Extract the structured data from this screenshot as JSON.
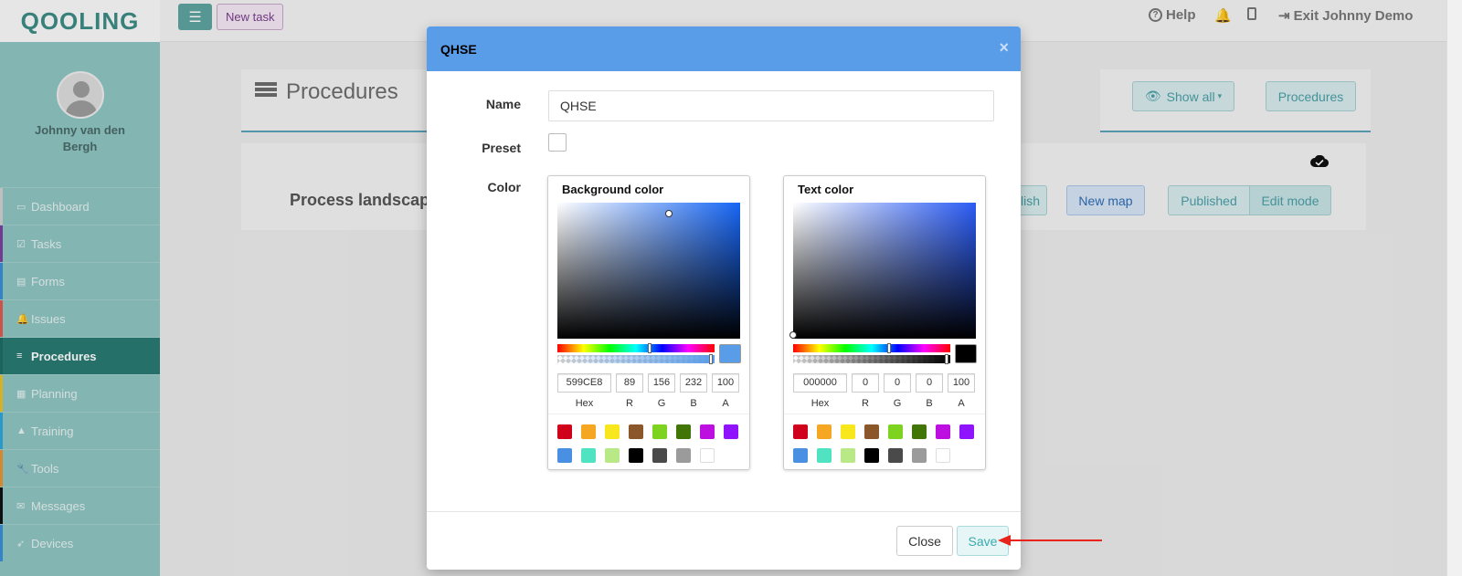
{
  "app": {
    "logo": "QOOLING",
    "new_task_label": "New task"
  },
  "topnav": {
    "help_label": "Help",
    "exit_label": "Exit Johnny Demo"
  },
  "user": {
    "name": "Johnny van den Bergh"
  },
  "sidebar": {
    "items": [
      {
        "label": "Dashboard",
        "icon": "monitor-icon",
        "accent": "#d0d0d0"
      },
      {
        "label": "Tasks",
        "icon": "check-square-icon",
        "accent": "#7b3fa0"
      },
      {
        "label": "Forms",
        "icon": "file-icon",
        "accent": "#3a8fd8"
      },
      {
        "label": "Issues",
        "icon": "bell-icon",
        "accent": "#e05a4f"
      },
      {
        "label": "Procedures",
        "icon": "list-icon",
        "accent": "#1f6b65",
        "active": true
      },
      {
        "label": "Planning",
        "icon": "calendar-icon",
        "accent": "#e6c229"
      },
      {
        "label": "Training",
        "icon": "graduation-icon",
        "accent": "#2fa6d8"
      },
      {
        "label": "Tools",
        "icon": "wrench-icon",
        "accent": "#e69332"
      },
      {
        "label": "Messages",
        "icon": "envelope-icon",
        "accent": "#111111"
      },
      {
        "label": "Devices",
        "icon": "rocket-icon",
        "accent": "#3a8fd8"
      }
    ]
  },
  "page": {
    "title": "Procedures",
    "show_all_label": "Show all",
    "procedures_button": "Procedures",
    "process_landscape": "Process landscap",
    "publish_partial": "lish",
    "new_map_label": "New map",
    "published_label": "Published",
    "edit_mode_label": "Edit mode"
  },
  "modal": {
    "title": "QHSE",
    "name_label": "Name",
    "name_value": "QHSE",
    "preset_label": "Preset",
    "color_label": "Color",
    "close_label": "Close",
    "save_label": "Save",
    "field_labels": [
      "Hex",
      "R",
      "G",
      "B",
      "A"
    ],
    "background": {
      "title": "Background color",
      "hex": "599CE8",
      "r": "89",
      "g": "156",
      "b": "232",
      "a": "100",
      "color": "#599ce8"
    },
    "text": {
      "title": "Text color",
      "hex": "000000",
      "r": "0",
      "g": "0",
      "b": "0",
      "a": "100",
      "color": "#000000"
    },
    "preset_colors": [
      "#d0021b",
      "#f5a623",
      "#f8e71c",
      "#8b572a",
      "#7ed321",
      "#417505",
      "#bd10e0",
      "#9013fe",
      "#4a90e2",
      "#50e3c2",
      "#b8e986",
      "#000000",
      "#4a4a4a",
      "#9b9b9b",
      "#ffffff"
    ]
  }
}
